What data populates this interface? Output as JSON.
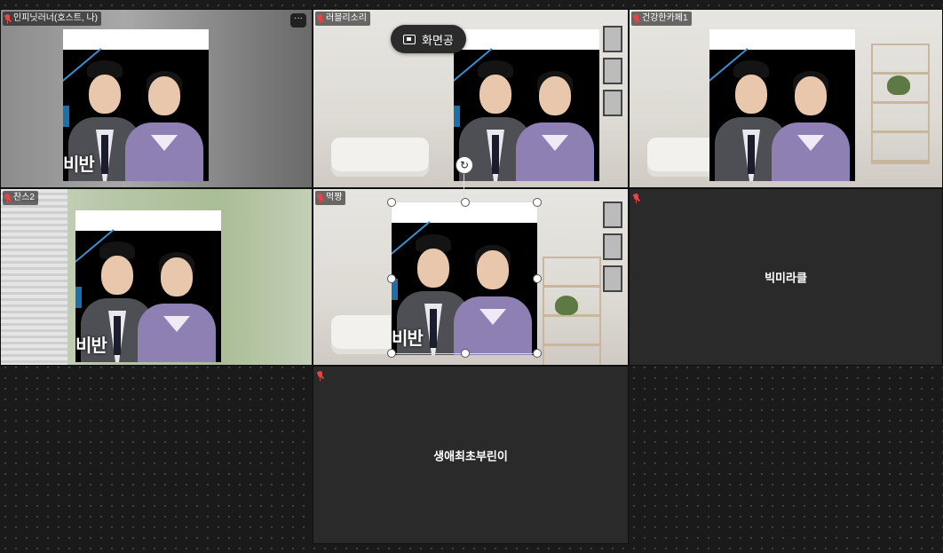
{
  "window": {
    "title": ""
  },
  "tiles": [
    {
      "name": "인피닛러너(호스트, 나)",
      "muted": true,
      "video": true
    },
    {
      "name": "러블리소리",
      "muted": true,
      "video": true
    },
    {
      "name": "건강한카페1",
      "muted": true,
      "video": true
    },
    {
      "name": "찬스2",
      "muted": true,
      "video": true
    },
    {
      "name": "먹짱",
      "muted": true,
      "video": true
    },
    {
      "name": "빅미라클",
      "muted": true,
      "video": false
    },
    {
      "name": "생애최초부린이",
      "muted": true,
      "video": false
    }
  ],
  "overlay": {
    "photo_caption": "비반",
    "more_button": "···"
  },
  "screen_share": {
    "label": "화면공"
  },
  "colors": {
    "background": "#1a1a1a",
    "empty_tile": "#2a2a2a",
    "mic_off": "#e04848"
  },
  "icons": {
    "mic": "mic-off-icon",
    "share": "screen-share-icon",
    "rotate": "rotate-icon"
  }
}
